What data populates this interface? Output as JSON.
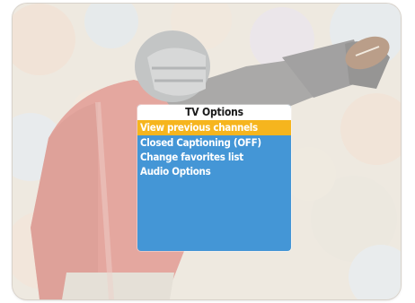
{
  "menu": {
    "title": "TV Options",
    "selected_index": 0,
    "items": [
      {
        "label": "View previous channels"
      },
      {
        "label": "Closed Captioning (OFF)"
      },
      {
        "label": "Change favorites list"
      },
      {
        "label": "Audio Options"
      }
    ]
  },
  "colors": {
    "menu_background": "#4496d6",
    "highlight": "#f6b51e",
    "title_background": "#ffffff",
    "jersey": "#d25a52",
    "helmet": "#8a8f96"
  },
  "background": {
    "subject": "football-player-catching-ball-illustration"
  }
}
